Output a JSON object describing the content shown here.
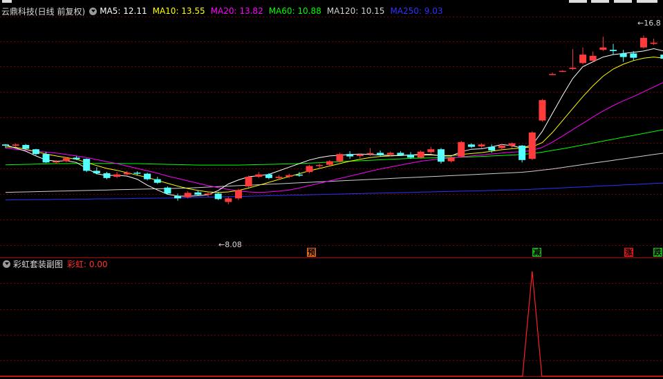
{
  "header": {
    "title": "云鼎科技(日线 前复权)",
    "ma5": "MA5: 12.11",
    "ma10": "MA10: 13.55",
    "ma20": "MA20: 13.82",
    "ma60": "MA60: 10.88",
    "ma120": "MA120: 10.15",
    "ma250": "MA250: 9.03"
  },
  "sub": {
    "title": "彩虹套装副图",
    "value": "彩虹: 0.00"
  },
  "labels": {
    "min": "←8.08",
    "max": "←16.8"
  },
  "signals": [
    {
      "text": "预",
      "color": "#e06818"
    },
    {
      "text": "减",
      "color": "#18b018"
    },
    {
      "text": "涨",
      "color": "#e01818"
    },
    {
      "text": "跌",
      "color": "#18b018"
    }
  ],
  "colors": {
    "up": "#ff3b3b",
    "down": "#54ffff",
    "ma5": "#ffffff",
    "ma10": "#ffff00",
    "ma20": "#ff00ff",
    "ma60": "#00ff00",
    "ma120": "#d0d0d0",
    "ma250": "#3030ff",
    "grid": "#7a0000",
    "rainbow": "#ff2020"
  },
  "chart_data": {
    "type": "candlestick",
    "candles": [
      [
        12.2,
        12.22,
        12.05,
        12.15
      ],
      [
        12.15,
        12.25,
        12.08,
        12.2
      ],
      [
        12.18,
        12.22,
        11.98,
        12.02
      ],
      [
        12.0,
        12.02,
        11.75,
        11.8
      ],
      [
        11.8,
        11.9,
        11.42,
        11.45
      ],
      [
        11.45,
        11.55,
        11.38,
        11.5
      ],
      [
        11.5,
        11.68,
        11.45,
        11.63
      ],
      [
        11.65,
        11.72,
        11.55,
        11.58
      ],
      [
        11.6,
        11.62,
        11.05,
        11.1
      ],
      [
        11.1,
        11.25,
        10.95,
        11.0
      ],
      [
        11.0,
        11.05,
        10.75,
        10.8
      ],
      [
        10.85,
        11.05,
        10.8,
        10.95
      ],
      [
        10.95,
        11.1,
        10.92,
        11.02
      ],
      [
        11.0,
        11.08,
        10.9,
        10.98
      ],
      [
        10.98,
        11.02,
        10.7,
        10.75
      ],
      [
        10.75,
        10.85,
        10.55,
        10.6
      ],
      [
        10.4,
        10.45,
        10.1,
        10.15
      ],
      [
        10.05,
        10.15,
        9.85,
        9.95
      ],
      [
        10.0,
        10.25,
        9.95,
        10.18
      ],
      [
        10.2,
        10.28,
        10.05,
        10.1
      ],
      [
        10.1,
        10.2,
        10.02,
        10.15
      ],
      [
        10.15,
        10.22,
        9.88,
        9.92
      ],
      [
        9.8,
        10.02,
        9.7,
        9.95
      ],
      [
        9.95,
        10.35,
        9.88,
        10.3
      ],
      [
        10.45,
        10.9,
        10.4,
        10.85
      ],
      [
        10.85,
        11.05,
        10.8,
        10.95
      ],
      [
        10.95,
        11.0,
        10.75,
        10.8
      ],
      [
        10.8,
        10.92,
        10.72,
        10.85
      ],
      [
        10.85,
        10.98,
        10.8,
        10.92
      ],
      [
        10.92,
        11.05,
        10.85,
        10.88
      ],
      [
        11.05,
        11.35,
        11.0,
        11.3
      ],
      [
        11.3,
        11.4,
        11.2,
        11.32
      ],
      [
        11.35,
        11.55,
        11.3,
        11.5
      ],
      [
        11.5,
        11.85,
        11.45,
        11.8
      ],
      [
        11.8,
        11.92,
        11.6,
        11.7
      ],
      [
        11.72,
        11.82,
        11.62,
        11.78
      ],
      [
        11.78,
        12.05,
        11.72,
        11.82
      ],
      [
        11.85,
        11.95,
        11.7,
        11.75
      ],
      [
        11.78,
        11.9,
        11.7,
        11.85
      ],
      [
        11.85,
        11.92,
        11.72,
        11.75
      ],
      [
        11.78,
        11.88,
        11.6,
        11.65
      ],
      [
        11.65,
        11.95,
        11.6,
        11.9
      ],
      [
        11.88,
        12.1,
        11.82,
        12.0
      ],
      [
        12.0,
        12.05,
        11.4,
        11.48
      ],
      [
        11.5,
        11.7,
        11.45,
        11.65
      ],
      [
        11.7,
        12.35,
        11.65,
        12.3
      ],
      [
        12.2,
        12.25,
        12.05,
        12.1
      ],
      [
        12.12,
        12.25,
        12.05,
        12.2
      ],
      [
        12.1,
        12.2,
        11.85,
        11.95
      ],
      [
        12.05,
        12.22,
        11.95,
        12.15
      ],
      [
        12.15,
        12.28,
        12.05,
        12.25
      ],
      [
        12.15,
        12.18,
        11.45,
        11.55
      ],
      [
        11.6,
        12.75,
        11.55,
        12.7
      ],
      [
        13.2,
        14.1,
        13.15,
        14.05
      ],
      [
        15.1,
        15.2,
        15.1,
        15.12
      ],
      [
        15.22,
        15.3,
        15.22,
        15.25
      ],
      [
        15.35,
        16.18,
        15.3,
        15.4
      ],
      [
        15.6,
        16.25,
        15.55,
        15.95
      ],
      [
        15.7,
        16.08,
        15.65,
        15.9
      ],
      [
        16.15,
        16.7,
        16.1,
        16.25
      ],
      [
        16.15,
        16.4,
        15.95,
        16.1
      ],
      [
        16.0,
        16.15,
        15.65,
        15.85
      ],
      [
        16.0,
        16.1,
        15.7,
        15.82
      ],
      [
        16.25,
        16.75,
        16.2,
        16.65
      ],
      [
        16.4,
        16.62,
        16.35,
        16.45
      ],
      [
        15.95,
        16.0,
        15.7,
        15.78
      ],
      [
        15.95,
        16.02,
        15.55,
        15.62
      ]
    ],
    "ma5": [
      12.18,
      12.05,
      11.92,
      11.72,
      11.55,
      11.5,
      11.52,
      11.45,
      11.2,
      10.98,
      10.9,
      10.92,
      10.88,
      10.75,
      10.5,
      10.3,
      10.12,
      10.05,
      10.04,
      10.06,
      10.1,
      10.28,
      10.55,
      10.72,
      10.85,
      10.9,
      10.95,
      11.1,
      11.25,
      11.4,
      11.55,
      11.65,
      11.72,
      11.75,
      11.78,
      11.8,
      11.78,
      11.76,
      11.74,
      11.74,
      11.76,
      11.78,
      11.78,
      11.72,
      11.72,
      11.9,
      12.0,
      12.02,
      12.1,
      12.2,
      12.15,
      12.05,
      12.18,
      12.75,
      13.5,
      14.25,
      14.95,
      15.45,
      15.65,
      15.85,
      15.95,
      16.0,
      16.05,
      16.1,
      16.2,
      16.1,
      15.95
    ],
    "ma10": [
      12.1,
      12.08,
      12.0,
      11.9,
      11.8,
      11.72,
      11.65,
      11.58,
      11.45,
      11.32,
      11.2,
      11.12,
      11.02,
      10.92,
      10.82,
      10.7,
      10.58,
      10.46,
      10.36,
      10.28,
      10.22,
      10.2,
      10.22,
      10.28,
      10.38,
      10.5,
      10.62,
      10.74,
      10.86,
      10.98,
      11.1,
      11.2,
      11.3,
      11.4,
      11.5,
      11.58,
      11.65,
      11.7,
      11.72,
      11.74,
      11.76,
      11.76,
      11.76,
      11.74,
      11.74,
      11.78,
      11.82,
      11.86,
      11.92,
      11.98,
      12.02,
      12.05,
      12.1,
      12.28,
      12.7,
      13.2,
      13.7,
      14.2,
      14.65,
      15.05,
      15.35,
      15.55,
      15.7,
      15.8,
      15.85,
      15.8,
      15.75
    ],
    "ma20": [
      12.05,
      12.0,
      11.95,
      11.92,
      11.88,
      11.84,
      11.78,
      11.72,
      11.65,
      11.57,
      11.48,
      11.4,
      11.3,
      11.2,
      11.1,
      11.0,
      10.88,
      10.78,
      10.68,
      10.58,
      10.48,
      10.4,
      10.32,
      10.26,
      10.22,
      10.2,
      10.22,
      10.25,
      10.3,
      10.38,
      10.48,
      10.58,
      10.68,
      10.78,
      10.88,
      10.98,
      11.08,
      11.18,
      11.26,
      11.34,
      11.42,
      11.5,
      11.55,
      11.6,
      11.64,
      11.68,
      11.72,
      11.76,
      11.8,
      11.84,
      11.88,
      11.9,
      11.95,
      12.08,
      12.3,
      12.55,
      12.82,
      13.08,
      13.35,
      13.6,
      13.82,
      14.02,
      14.2,
      14.4,
      14.6,
      14.8,
      14.95
    ],
    "ma60": [
      11.35,
      11.36,
      11.37,
      11.38,
      11.39,
      11.4,
      11.4,
      11.41,
      11.41,
      11.41,
      11.41,
      11.41,
      11.4,
      11.4,
      11.39,
      11.38,
      11.37,
      11.36,
      11.35,
      11.34,
      11.34,
      11.34,
      11.34,
      11.34,
      11.35,
      11.36,
      11.37,
      11.38,
      11.39,
      11.4,
      11.42,
      11.44,
      11.46,
      11.48,
      11.5,
      11.52,
      11.54,
      11.56,
      11.58,
      11.6,
      11.62,
      11.63,
      11.64,
      11.65,
      11.66,
      11.67,
      11.68,
      11.7,
      11.72,
      11.74,
      11.76,
      11.78,
      11.82,
      11.88,
      11.95,
      12.02,
      12.1,
      12.18,
      12.26,
      12.34,
      12.42,
      12.5,
      12.58,
      12.66,
      12.74,
      12.82,
      12.9
    ],
    "ma120": [
      10.2,
      10.21,
      10.22,
      10.23,
      10.24,
      10.25,
      10.26,
      10.27,
      10.28,
      10.29,
      10.3,
      10.31,
      10.32,
      10.33,
      10.34,
      10.35,
      10.36,
      10.37,
      10.38,
      10.4,
      10.42,
      10.44,
      10.46,
      10.48,
      10.5,
      10.52,
      10.54,
      10.56,
      10.58,
      10.6,
      10.62,
      10.64,
      10.66,
      10.68,
      10.7,
      10.72,
      10.74,
      10.76,
      10.78,
      10.8,
      10.82,
      10.84,
      10.86,
      10.88,
      10.9,
      10.92,
      10.94,
      10.96,
      10.98,
      11.0,
      11.02,
      11.04,
      11.08,
      11.13,
      11.18,
      11.24,
      11.3,
      11.36,
      11.42,
      11.48,
      11.54,
      11.6,
      11.66,
      11.72,
      11.78,
      11.84,
      11.9
    ],
    "ma250": [
      9.88,
      9.89,
      9.89,
      9.9,
      9.9,
      9.91,
      9.91,
      9.92,
      9.92,
      9.93,
      9.93,
      9.94,
      9.94,
      9.95,
      9.95,
      9.96,
      9.96,
      9.97,
      9.98,
      9.99,
      10.0,
      10.01,
      10.02,
      10.03,
      10.04,
      10.05,
      10.06,
      10.07,
      10.08,
      10.09,
      10.1,
      10.11,
      10.12,
      10.13,
      10.14,
      10.15,
      10.16,
      10.17,
      10.18,
      10.19,
      10.2,
      10.21,
      10.22,
      10.23,
      10.24,
      10.25,
      10.26,
      10.27,
      10.28,
      10.29,
      10.3,
      10.31,
      10.33,
      10.35,
      10.37,
      10.39,
      10.41,
      10.43,
      10.45,
      10.47,
      10.49,
      10.51,
      10.53,
      10.55,
      10.57,
      10.59,
      10.62
    ],
    "rainbow_spike_index": 52,
    "rainbow_value": 0.0
  }
}
